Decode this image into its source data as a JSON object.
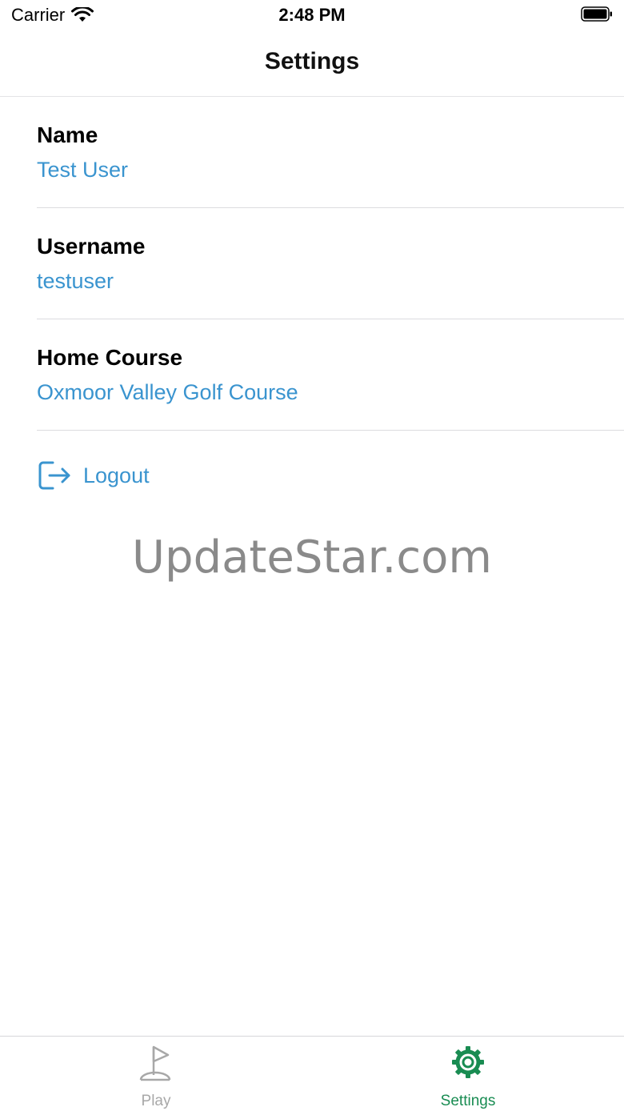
{
  "status_bar": {
    "carrier": "Carrier",
    "time": "2:48 PM",
    "icons": [
      "wifi-icon",
      "battery-icon"
    ]
  },
  "nav": {
    "title": "Settings"
  },
  "settings": {
    "name_label": "Name",
    "name_value": "Test User",
    "username_label": "Username",
    "username_value": "testuser",
    "home_course_label": "Home Course",
    "home_course_value": "Oxmoor Valley Golf Course"
  },
  "logout": {
    "label": "Logout",
    "icon": "logout-icon"
  },
  "watermark": "UpdateStar.com",
  "tabs": [
    {
      "label": "Play",
      "icon": "golf-flag-icon",
      "active": false
    },
    {
      "label": "Settings",
      "icon": "gear-icon",
      "active": true
    }
  ],
  "colors": {
    "link": "#3a94cf",
    "active_tab": "#198c52",
    "inactive_tab": "#a8a8a8"
  }
}
